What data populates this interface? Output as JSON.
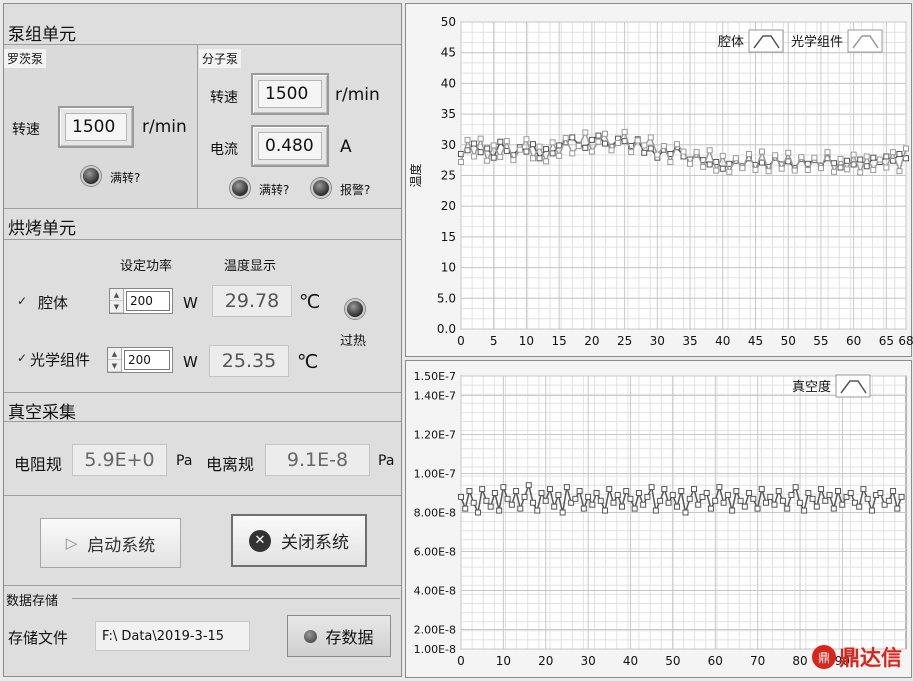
{
  "pump_unit": {
    "title": "泵组单元",
    "roots_pump": {
      "title": "罗茨泵",
      "speed_label": "转速",
      "speed_value": "1500",
      "speed_unit": "r/min",
      "full_speed_label": "满转?"
    },
    "molecular_pump": {
      "title": "分子泵",
      "speed_label": "转速",
      "speed_value": "1500",
      "speed_unit": "r/min",
      "current_label": "电流",
      "current_value": "0.480",
      "current_unit": "A",
      "full_speed_label": "满转?",
      "alarm_label": "报警?"
    }
  },
  "bake_unit": {
    "title": "烘烤单元",
    "power_header": "设定功率",
    "temp_header": "温度显示",
    "overheat_label": "过热",
    "rows": [
      {
        "label": "腔体",
        "checked": "✓",
        "power": "200",
        "power_unit": "W",
        "temp": "29.78",
        "temp_unit": "℃"
      },
      {
        "label": "光学组件",
        "checked": "✓",
        "power": "200",
        "power_unit": "W",
        "temp": "25.35",
        "temp_unit": "℃"
      }
    ]
  },
  "vacuum": {
    "title": "真空采集",
    "resistance_label": "电阻规",
    "resistance_value": "5.9E+0",
    "resistance_unit": "Pa",
    "ion_label": "电离规",
    "ion_value": "9.1E-8",
    "ion_unit": "Pa"
  },
  "controls": {
    "start_label": "启动系统",
    "stop_label": "关闭系统"
  },
  "storage": {
    "title": "数据存储",
    "file_label": "存储文件",
    "file_value": "F:\\ Data\\2019-3-15",
    "save_label": "存数据"
  },
  "watermark": "鼎达信",
  "chart_data": [
    {
      "type": "line",
      "ylabel": "温度",
      "xlabel": "",
      "xlim": [
        0,
        68
      ],
      "ylim": [
        0,
        50
      ],
      "x_ticks": [
        "0",
        "5",
        "10",
        "15",
        "20",
        "25",
        "30",
        "35",
        "40",
        "45",
        "50",
        "55",
        "60",
        "65",
        "68"
      ],
      "y_ticks": [
        "0.0",
        "5.0",
        "10",
        "15",
        "20",
        "25",
        "30",
        "35",
        "40",
        "45",
        "50"
      ],
      "legend_position": "top-right",
      "grid": true,
      "series": [
        {
          "name": "腔体",
          "color": "#555555",
          "values": [
            28.5,
            29.1,
            30.2,
            28.8,
            29.4,
            27.9,
            30.5,
            29.0,
            28.3,
            29.6,
            28.9,
            30.1,
            27.8,
            29.3,
            28.6,
            29.9,
            30.4,
            31.2,
            30.0,
            29.5,
            30.8,
            31.5,
            30.2,
            29.7,
            31.0,
            30.6,
            29.8,
            30.9,
            28.7,
            29.4,
            27.9,
            29.2,
            28.5,
            29.6,
            28.1,
            27.6,
            28.4,
            27.5,
            26.8,
            27.2,
            26.1,
            26.9,
            27.4,
            26.5,
            27.8,
            26.7,
            27.1,
            26.4,
            27.9,
            26.8,
            27.3,
            26.2,
            27.7,
            26.9,
            27.5,
            26.6,
            27.8,
            27.0,
            26.3,
            27.4,
            26.8,
            27.6,
            26.5,
            27.9,
            27.2,
            28.1,
            27.4,
            28.5,
            27.8
          ]
        },
        {
          "name": "光学组件",
          "color": "#9a9a9a",
          "values": [
            27.2,
            30.8,
            28.1,
            31.0,
            27.4,
            29.9,
            28.0,
            30.6,
            27.5,
            29.2,
            30.9,
            27.8,
            29.7,
            27.3,
            30.4,
            28.2,
            31.1,
            28.6,
            29.8,
            32.0,
            28.9,
            30.5,
            31.8,
            29.1,
            30.3,
            32.1,
            28.8,
            30.7,
            29.9,
            31.2,
            28.4,
            29.8,
            27.2,
            30.1,
            28.9,
            26.9,
            28.8,
            26.4,
            29.1,
            25.8,
            28.2,
            25.6,
            27.8,
            26.2,
            28.5,
            25.9,
            28.9,
            25.7,
            28.3,
            26.1,
            28.7,
            25.8,
            28.0,
            25.9,
            27.9,
            26.2,
            28.8,
            25.6,
            27.7,
            26.0,
            28.4,
            25.5,
            28.1,
            25.9,
            27.6,
            26.3,
            28.8,
            25.7,
            29.4
          ]
        }
      ]
    },
    {
      "type": "line",
      "ylabel": "",
      "xlabel": "",
      "xlim": [
        0,
        105
      ],
      "ylim": [
        1e-08,
        1.5e-07
      ],
      "x_ticks": [
        "0",
        "10",
        "20",
        "30",
        "40",
        "50",
        "60",
        "70",
        "80",
        "90"
      ],
      "y_ticks": [
        "1.00E-8",
        "2.00E-8",
        "4.00E-8",
        "6.00E-8",
        "8.00E-8",
        "1.00E-7",
        "1.20E-7",
        "1.40E-7",
        "1.50E-7"
      ],
      "legend_position": "top-right",
      "grid": true,
      "series": [
        {
          "name": "真空度",
          "color": "#555555",
          "values": [
            8.8,
            8.2,
            9.1,
            8.5,
            8.0,
            9.2,
            8.6,
            8.3,
            9.0,
            8.1,
            9.3,
            8.7,
            8.4,
            9.1,
            8.2,
            8.8,
            9.4,
            8.5,
            8.1,
            9.0,
            8.6,
            9.2,
            8.3,
            8.9,
            8.0,
            9.3,
            8.5,
            8.7,
            9.1,
            8.2,
            8.8,
            8.4,
            9.0,
            8.6,
            8.1,
            9.2,
            8.5,
            8.9,
            8.3,
            9.1,
            8.7,
            8.2,
            9.0,
            8.4,
            8.8,
            9.3,
            8.1,
            8.6,
            9.2,
            8.5,
            8.9,
            8.3,
            9.1,
            8.0,
            8.7,
            9.2,
            8.4,
            8.8,
            9.0,
            8.2,
            8.6,
            9.3,
            8.5,
            8.9,
            8.1,
            9.1,
            8.6,
            8.3,
            9.0,
            8.7,
            8.2,
            9.2,
            8.5,
            8.8,
            8.4,
            9.1,
            8.6,
            8.2,
            8.9,
            9.3,
            8.5,
            8.1,
            9.0,
            8.7,
            8.3,
            9.2,
            8.6,
            8.9,
            8.2,
            9.1,
            8.4,
            8.8,
            9.0,
            8.5,
            8.3,
            9.2,
            8.7,
            8.1,
            8.9,
            9.0,
            8.4,
            8.6,
            9.1,
            8.2,
            8.8
          ]
        }
      ]
    }
  ]
}
